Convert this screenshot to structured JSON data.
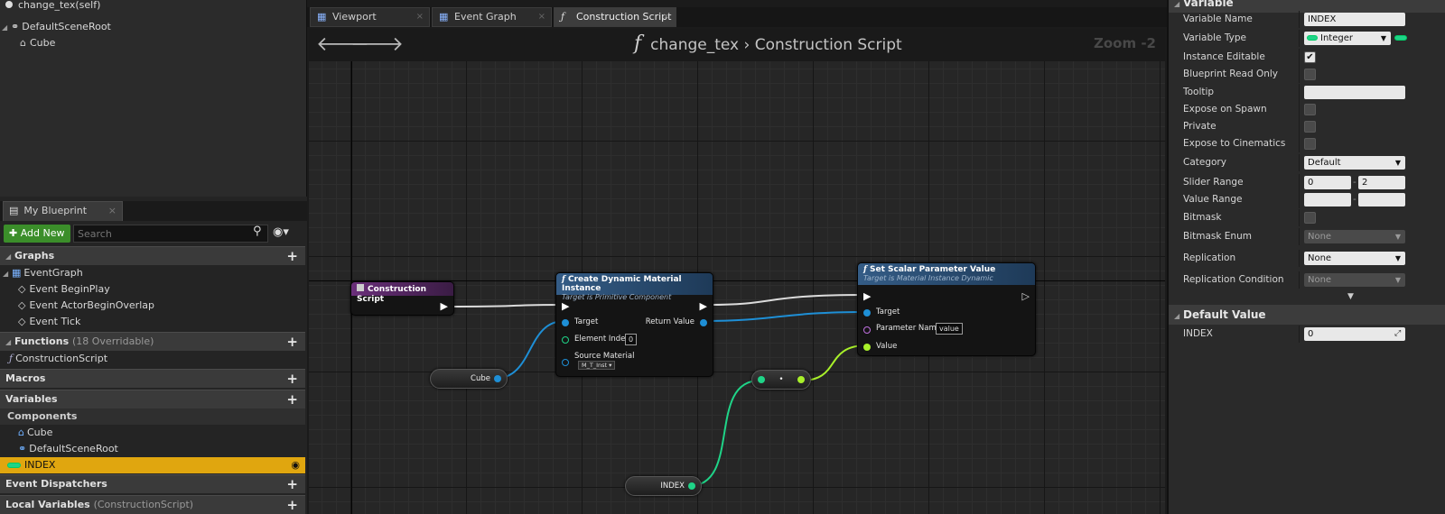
{
  "components_panel": {
    "self_label": "change_tex(self)",
    "root_label": "DefaultSceneRoot",
    "child_label": "Cube"
  },
  "my_blueprint": {
    "tab_label": "My Blueprint",
    "add_new_label": "Add New",
    "search_placeholder": "Search",
    "graphs": {
      "label": "Graphs",
      "items": [
        "EventGraph",
        "Event BeginPlay",
        "Event ActorBeginOverlap",
        "Event Tick"
      ]
    },
    "functions": {
      "label": "Functions",
      "overridable": "(18 Overridable)",
      "items": [
        "ConstructionScript"
      ]
    },
    "macros_label": "Macros",
    "variables": {
      "label": "Variables",
      "components_label": "Components",
      "components": [
        "Cube",
        "DefaultSceneRoot"
      ],
      "selected_var": "INDEX"
    },
    "event_dispatchers_label": "Event Dispatchers",
    "local_variables_label": "Local Variables",
    "local_variables_sub": "(ConstructionScript)"
  },
  "graph_tabs": [
    "Viewport",
    "Event Graph",
    "Construction Script"
  ],
  "graph": {
    "breadcrumb_owner": "change_tex",
    "breadcrumb_sep": "›",
    "breadcrumb_graph": "Construction Script",
    "zoom": "Zoom -2",
    "nodes": {
      "construction": {
        "title": "Construction Script"
      },
      "create_dmi": {
        "title": "Create Dynamic Material Instance",
        "subtitle": "Target is Primitive Component",
        "pin_target": "Target",
        "pin_element_index": "Element Index",
        "element_index_value": "0",
        "pin_source_material": "Source Material",
        "source_material_value": "M_T_Inst ▾",
        "pin_return": "Return Value"
      },
      "set_scalar": {
        "title": "Set Scalar Parameter Value",
        "subtitle": "Target is Material Instance Dynamic",
        "pin_target": "Target",
        "pin_param_name": "Parameter Name",
        "param_name_value": "value",
        "pin_value": "Value"
      },
      "cube_var": {
        "label": "Cube"
      },
      "index_var": {
        "label": "INDEX"
      },
      "convert": {
        "label": "•"
      }
    }
  },
  "details": {
    "variable_section": "Variable",
    "rows": {
      "var_name": {
        "label": "Variable Name",
        "value": "INDEX"
      },
      "var_type": {
        "label": "Variable Type",
        "value": "Integer"
      },
      "instance_editable": {
        "label": "Instance Editable",
        "checked": "✔"
      },
      "bp_read_only": {
        "label": "Blueprint Read Only"
      },
      "tooltip": {
        "label": "Tooltip",
        "value": ""
      },
      "expose_spawn": {
        "label": "Expose on Spawn"
      },
      "private": {
        "label": "Private"
      },
      "expose_cine": {
        "label": "Expose to Cinematics"
      },
      "category": {
        "label": "Category",
        "value": "Default"
      },
      "slider_range": {
        "label": "Slider Range",
        "min": "0",
        "max": "2"
      },
      "value_range": {
        "label": "Value Range"
      },
      "bitmask": {
        "label": "Bitmask"
      },
      "bitmask_enum": {
        "label": "Bitmask Enum",
        "value": "None"
      },
      "replication": {
        "label": "Replication",
        "value": "None"
      },
      "replication_cond": {
        "label": "Replication Condition",
        "value": "None"
      }
    },
    "default_section": "Default Value",
    "default_row": {
      "label": "INDEX",
      "value": "0"
    }
  },
  "colors": {
    "accent_orange": "#e0a60f",
    "exec_wire": "#dcdcdc",
    "object_wire": "#1e8fd6",
    "int_wire": "#1fd488",
    "float_wire": "#a8f02a",
    "function_header": "#2d4e72",
    "event_header": "#5a2a66",
    "add_new_green": "#3b8e2a"
  }
}
